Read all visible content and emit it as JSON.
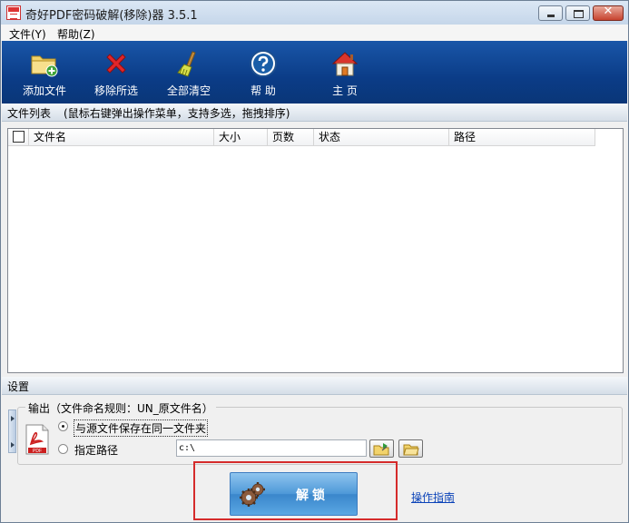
{
  "window": {
    "title": "奇好PDF密码破解(移除)器 3.5.1",
    "close_glyph": "✕"
  },
  "menu": {
    "items": [
      {
        "label": "文件(Y)"
      },
      {
        "label": "帮助(Z)"
      }
    ]
  },
  "toolbar": {
    "buttons": [
      {
        "label": "添加文件",
        "icon": "add-folder-icon"
      },
      {
        "label": "移除所选",
        "icon": "red-x-icon"
      },
      {
        "label": "全部清空",
        "icon": "broom-icon"
      },
      {
        "label": "帮  助",
        "icon": "help-icon"
      },
      {
        "label": "主  页",
        "icon": "home-icon"
      }
    ]
  },
  "file_list": {
    "section_title": "文件列表",
    "hint": "(鼠标右键弹出操作菜单，支持多选，拖拽排序)",
    "columns": [
      "文件名",
      "大小",
      "页数",
      "状态",
      "路径"
    ]
  },
  "settings": {
    "section_title": "设置",
    "output_legend": "输出（文件命名规则：UN_原文件名）",
    "option_same_folder": "与源文件保存在同一文件夹",
    "option_custom_path": "指定路径",
    "selected_option": "same_folder",
    "path_value": "c:\\"
  },
  "actions": {
    "unlock_label": "解锁",
    "guide_link": "操作指南"
  },
  "colors": {
    "toolbar_bg": "#0b3c87",
    "unlock_btn": "#4d98d8",
    "highlight_frame": "#d52b2b",
    "link": "#0b43b8"
  }
}
